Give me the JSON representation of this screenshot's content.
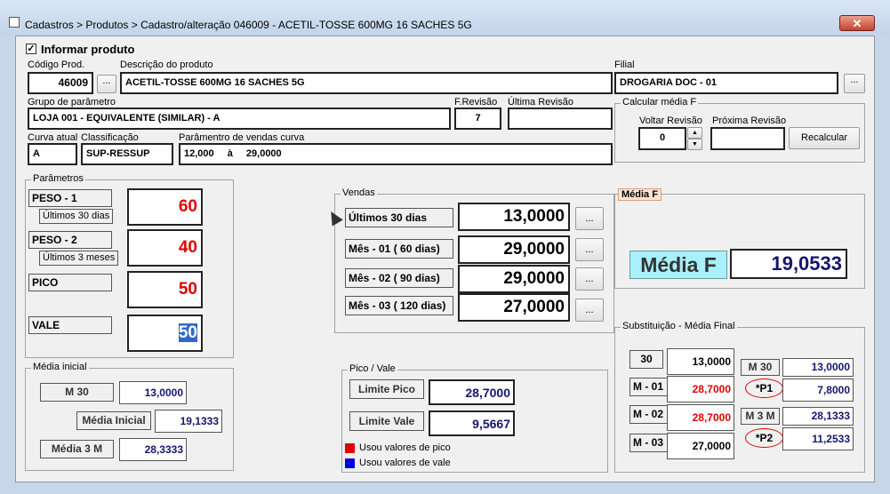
{
  "window": {
    "title": "Cadastros > Produtos > Cadastro/alteração  046009 - ACETIL-TOSSE 600MG 16 SACHES 5G",
    "close": "✕"
  },
  "header": {
    "informar_label": "Informar produto",
    "codigo_label": "Código Prod.",
    "codigo": "46009",
    "descricao_label": "Descrição do  produto",
    "descricao": "ACETIL-TOSSE 600MG 16 SACHES 5G",
    "filial_label": "Filial",
    "filial": "DROGARIA DOC - 01",
    "grupo_label": "Grupo de parâmetro",
    "grupo": "LOJA 001 - EQUIVALENTE (SIMILAR) - A",
    "frevisao_label": "F.Revisão",
    "frevisao": "7",
    "ultima_label": "Última Revisão",
    "ultima": "",
    "curva_label": "Curva atual",
    "curva": "A",
    "classif_label": "Classificação",
    "classif": "SUP-RESSUP",
    "param_label": "Parâmentro de vendas curva",
    "param_from": "12,000",
    "param_a": "à",
    "param_to": "29,0000",
    "ellipsis": "..."
  },
  "calc": {
    "title": "Calcular média F",
    "voltar_label": "Voltar Revisão",
    "voltar": "0",
    "proxima_label": "Próxima Revisão",
    "proxima": "",
    "recalc": "Recalcular",
    "up": "▲",
    "down": "▼"
  },
  "parametros": {
    "title": "Parâmetros",
    "peso1": "PESO - 1",
    "peso1_sub": "Últimos 30 dias",
    "peso1_val": "60",
    "peso2": "PESO - 2",
    "peso2_sub": "Últimos 3 meses",
    "peso2_val": "40",
    "pico": "PICO",
    "pico_val": "50",
    "vale": "VALE",
    "vale_val": "50"
  },
  "vendas": {
    "title": "Vendas",
    "rows": [
      {
        "label": "Últimos 30 dias",
        "value": "13,0000"
      },
      {
        "label": "Mês - 01 ( 60 dias)",
        "value": "29,0000"
      },
      {
        "label": "Mês - 02 ( 90 dias)",
        "value": "29,0000"
      },
      {
        "label": "Mês - 03 ( 120 dias)",
        "value": "27,0000"
      }
    ],
    "btn": "..."
  },
  "mediaf": {
    "title": "Média F",
    "label": "Média F",
    "value": "19,0533"
  },
  "media_inicial": {
    "title": "Média inicial",
    "m30": "M 30",
    "m30_val": "13,0000",
    "mi": "Média Inicial",
    "mi_val": "19,1333",
    "m3m": "Média 3 M",
    "m3m_val": "28,3333"
  },
  "pico_vale": {
    "title": "Pico / Vale",
    "limite_pico": "Limite Pico",
    "limite_pico_val": "28,7000",
    "limite_vale": "Limite Vale",
    "limite_vale_val": "9,5667",
    "legend_pico": "Usou valores de pico",
    "legend_vale": "Usou valores de vale",
    "pico_color": "#e00000",
    "vale_color": "#0000e0"
  },
  "substituicao": {
    "title": "Substituição - Média Final",
    "r30": "30",
    "r30_val": "13,0000",
    "m01": "M - 01",
    "m01_val": "28,7000",
    "m02": "M - 02",
    "m02_val": "28,7000",
    "m03": "M - 03",
    "m03_val": "27,0000",
    "mm30": "M 30",
    "mm30_val": "13,0000",
    "p1": "*P1",
    "p1_val": "7,8000",
    "m3m": "M 3 M",
    "m3m_val": "28,1333",
    "p2": "*P2",
    "p2_val": "11,2533"
  }
}
